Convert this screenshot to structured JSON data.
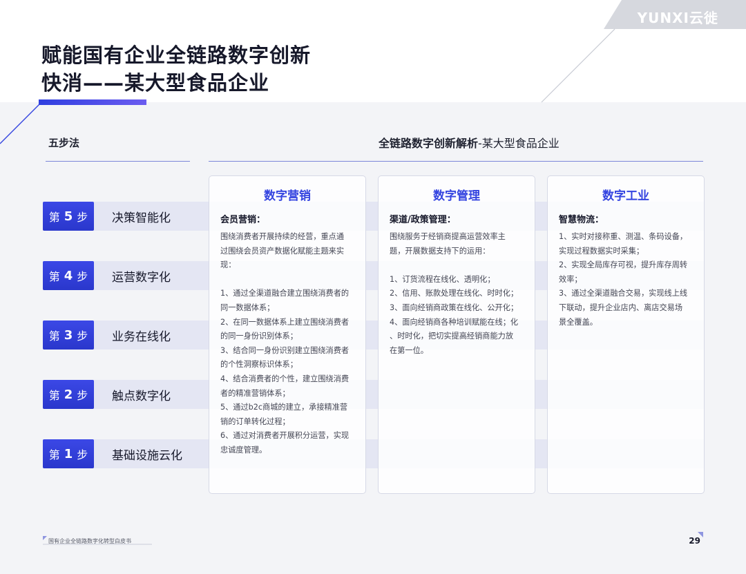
{
  "brand": {
    "logo_text": "YUNXI云徙"
  },
  "title": {
    "line1": "赋能国有企业全链路数字创新",
    "line2": "快消——某大型食品企业"
  },
  "left_section": {
    "heading": "五步法"
  },
  "right_section": {
    "heading_bold": "全链路数字创新解析",
    "heading_thin": "-某大型食品企业"
  },
  "steps": [
    {
      "prefix": "第",
      "number": "5",
      "suffix": "步",
      "name": "决策智能化"
    },
    {
      "prefix": "第",
      "number": "4",
      "suffix": "步",
      "name": "运营数字化"
    },
    {
      "prefix": "第",
      "number": "3",
      "suffix": "步",
      "name": "业务在线化"
    },
    {
      "prefix": "第",
      "number": "2",
      "suffix": "步",
      "name": "触点数字化"
    },
    {
      "prefix": "第",
      "number": "1",
      "suffix": "步",
      "name": "基础设施云化"
    }
  ],
  "columns": [
    {
      "title": "数字营销",
      "subtitle": "会员营销：",
      "lines": [
        "围绕消费者开展持续的经营，重点通",
        "过围绕会员资产数据化赋能主题来实",
        "现：",
        "",
        "1、通过全渠道融合建立围绕消费者的",
        "同一数据体系；",
        "2、在同一数据体系上建立围绕消费者",
        "的同一身份识别体系；",
        "3、结合同一身份识别建立围绕消费者",
        "的个性洞察标识体系；",
        "4、结合消费者的个性，建立围绕消费",
        "者的精准营销体系；",
        "5、通过b2c商城的建立，承接精准营",
        "销的订单转化过程；",
        "6、通过对消费者开展积分运营，实现",
        "忠诚度管理。"
      ]
    },
    {
      "title": "数字管理",
      "subtitle": "渠道/政策管理：",
      "lines": [
        "围绕服务于经销商提高运营效率主",
        "题，开展数据支持下的运用：",
        "",
        "1、订货流程在线化、透明化；",
        "2、信用、账款处理在线化、时时化；",
        "3、面向经销商政策在线化、公开化；",
        "4、面向经销商各种培训赋能在线；化",
        "、时时化，把切实提高经销商能力放",
        "在第一位。"
      ]
    },
    {
      "title": "数字工业",
      "subtitle": "智慧物流：",
      "lines": [
        "1、实时对接称重、测温、条码设备，",
        "实现过程数据实时采集；",
        "2、实现全局库存可视，提升库存周转",
        "效率；",
        "3、通过全渠道融合交易，实现线上线",
        "下联动，提升企业店内、离店交易场",
        "景全覆盖。"
      ]
    }
  ],
  "footer": {
    "document_title": "国有企业全链路数字化转型白皮书",
    "page_number": "29"
  },
  "colors": {
    "accent_blue": "#3444e0",
    "badge_blue": "#2f3cd8",
    "band_tint": "#e4e6f3",
    "corner_gray": "#d6d8de"
  }
}
